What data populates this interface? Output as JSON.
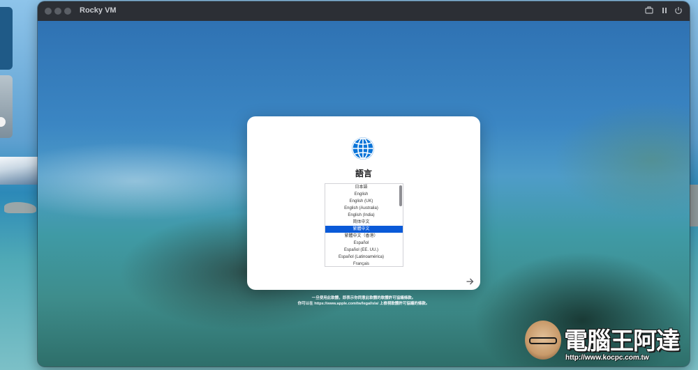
{
  "window": {
    "title": "Rocky VM",
    "toolbar_icons": [
      "screenshot-icon",
      "pause-icon",
      "power-icon"
    ]
  },
  "setup": {
    "title": "語言",
    "languages": [
      "日本語",
      "English",
      "English (UK)",
      "English (Australia)",
      "English (India)",
      "简体中文",
      "繁體中文",
      "繁體中文（香港）",
      "Español",
      "Español (EE. UU.)",
      "Español (Latinoamérica)",
      "Français"
    ],
    "selected_language": "繁體中文",
    "next_icon": "arrow-right-icon",
    "legal_line1": "一旦使用此軟體，即表示你同意此軟體的軟體許可協議條款。",
    "legal_line2": "你可以在 https://www.apple.com/tw/legal/sla/ 上檢視軟體許可協議的條款。"
  },
  "watermark": {
    "text": "電腦王阿達",
    "url": "http://www.kocpc.com.tw"
  },
  "colors": {
    "selection": "#0a5ad8",
    "globe": "#0a74d8",
    "titlebar": "#2c2f35"
  }
}
